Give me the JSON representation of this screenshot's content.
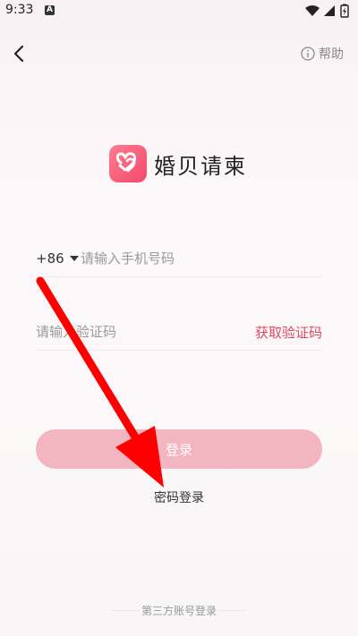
{
  "status_bar": {
    "time": "9:33",
    "app_badge": "A",
    "icons": [
      "wifi-icon",
      "signal-icon",
      "battery-icon"
    ]
  },
  "header": {
    "help_label": "帮助"
  },
  "brand": {
    "name": "婚贝请柬",
    "accent_color": "#f2496a"
  },
  "form": {
    "country_code": "+86",
    "phone_placeholder": "请输入手机号码",
    "code_placeholder": "请输入验证码",
    "get_code_label": "获取验证码",
    "login_label": "登录",
    "password_login_label": "密码登录"
  },
  "footer": {
    "third_party_label": "第三方账号登录"
  },
  "colors": {
    "button_bg": "#f3b5bf",
    "link_red": "#e0485f"
  }
}
